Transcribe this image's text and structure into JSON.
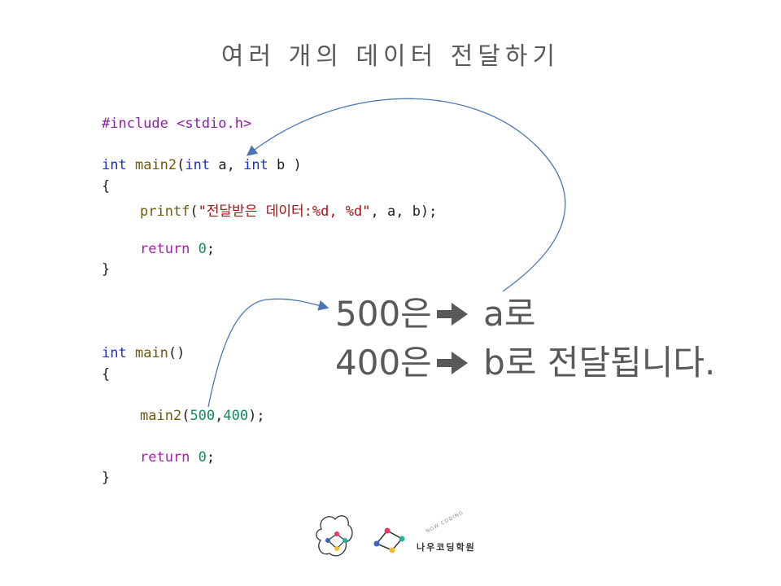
{
  "title": "여러 개의 데이터 전달하기",
  "code": {
    "include": "#include <stdio.h>",
    "l_int1": "int",
    "l_main2": "main2",
    "l_paren_open": "(",
    "l_int2": "int",
    "l_a": " a, ",
    "l_int3": "int",
    "l_b": " b )",
    "brace_open": "{",
    "brace_close": "}",
    "printf_fn": "printf",
    "printf_open": "(",
    "printf_str": "\"전달받은 데이터:%d, %d\"",
    "printf_args": ", a, b);",
    "return_kw": "return",
    "return_val": "0",
    "semicolon": ";",
    "main_int": "int",
    "main_name": "main",
    "main_parens": "()",
    "call_fn": "main2",
    "call_open": "(",
    "call_arg1": "500",
    "call_comma": ",",
    "call_arg2": "400",
    "call_close": ");"
  },
  "explanation": {
    "line1_value": "500은",
    "line1_target": "a로",
    "line2_value": "400은",
    "line2_target": "b로 전달됩니다."
  },
  "logo": {
    "arc_text": "NOW CODING",
    "name": "나우코딩학원"
  }
}
